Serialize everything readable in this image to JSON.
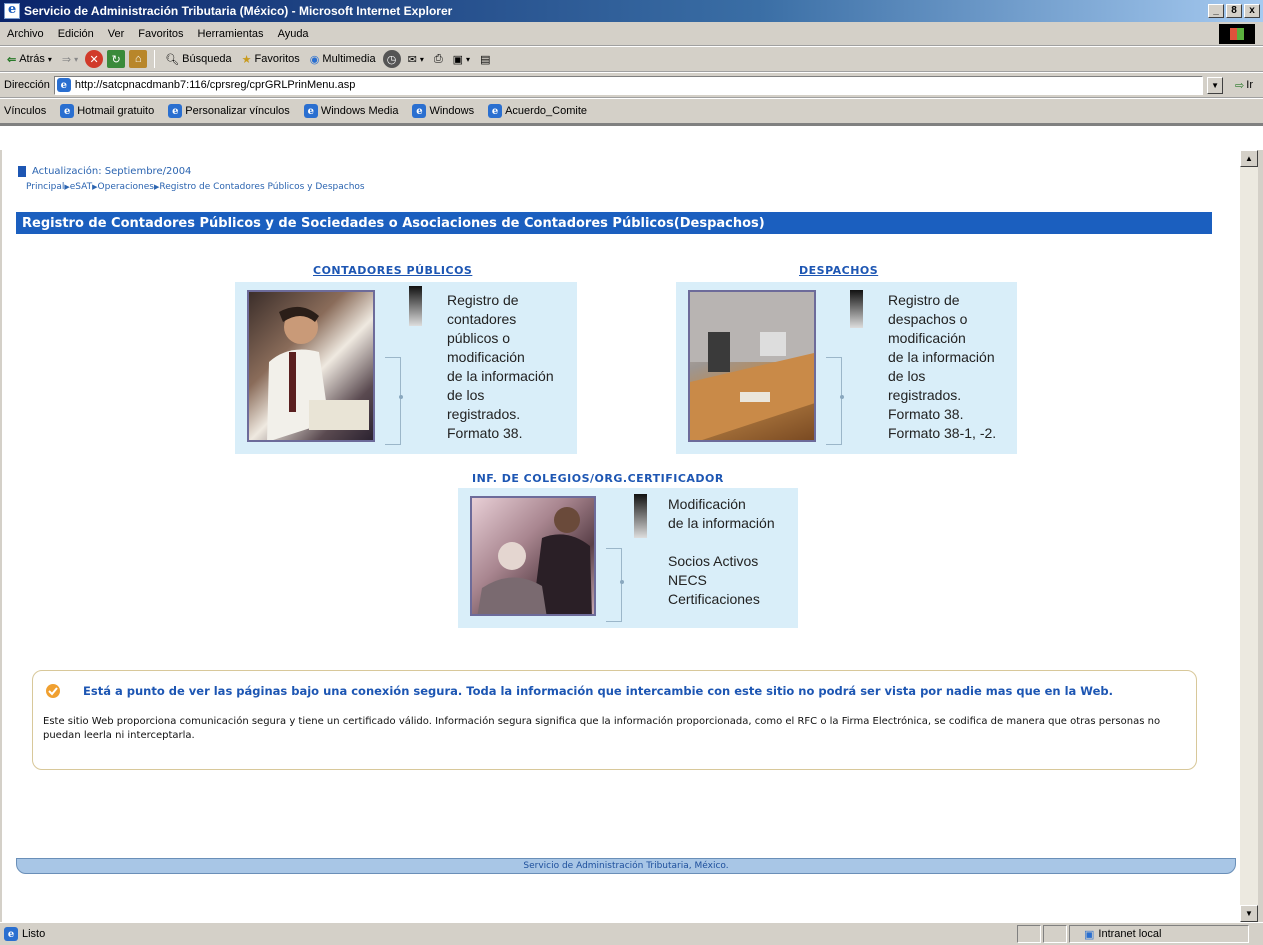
{
  "window": {
    "title": "Servicio de Administración Tributaria (México) - Microsoft Internet Explorer",
    "min": "_",
    "max": "8",
    "close": "x"
  },
  "menu": [
    "Archivo",
    "Edición",
    "Ver",
    "Favoritos",
    "Herramientas",
    "Ayuda"
  ],
  "toolbar": {
    "back": "Atrás",
    "search": "Búsqueda",
    "favorites": "Favoritos",
    "media": "Multimedia"
  },
  "address": {
    "label": "Dirección",
    "url": "http://satcpnacdmanb7:116/cprsreg/cprGRLPrinMenu.asp",
    "go": "Ir"
  },
  "links": {
    "label": "Vínculos",
    "items": [
      "Hotmail gratuito",
      "Personalizar vínculos",
      "Windows Media",
      "Windows",
      "Acuerdo_Comite"
    ]
  },
  "page": {
    "update": "Actualización: Septiembre/2004",
    "breadcrumb": [
      "Principal",
      "eSAT",
      "Operaciones",
      "Registro de Contadores Públicos y Despachos"
    ],
    "banner": "Registro de Contadores Públicos y de Sociedades o Asociaciones de Contadores Públicos(Despachos)",
    "contadores": {
      "title": "CONTADORES PÚBLICOS",
      "lines": [
        "Registro de",
        "contadores",
        "públicos o",
        "modificación",
        "de la información",
        "de los",
        "registrados.",
        "Formato 38."
      ]
    },
    "despachos": {
      "title": "DESPACHOS",
      "lines": [
        "Registro de",
        "despachos o",
        "modificación",
        "de la información",
        "de los",
        "registrados.",
        "Formato 38.",
        "Formato 38-1, -2."
      ]
    },
    "colegios": {
      "title": "INF. DE COLEGIOS/ORG.CERTIFICADOR",
      "lines": [
        "Modificación",
        "de la información",
        "",
        "Socios Activos",
        "NECS",
        "Certificaciones"
      ]
    },
    "notice": {
      "heading": "Está a punto de ver las páginas bajo una conexión segura. Toda la información que intercambie con este sitio no podrá ser vista por nadie mas que en la Web.",
      "body": "Este sitio Web proporciona comunicación segura y tiene un certificado válido. Información segura significa que la información proporcionada, como el RFC o la Firma Electrónica, se codifica de manera que otras personas no puedan leerla ni interceptarla."
    },
    "footer": "Servicio de Administración Tributaria, México."
  },
  "status": {
    "text": "Listo",
    "zone": "Intranet local"
  }
}
